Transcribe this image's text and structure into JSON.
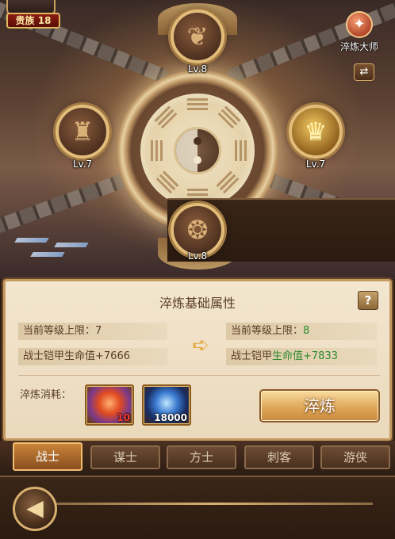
{
  "header": {
    "noble_badge": "贵族 18",
    "master_label": "淬炼大师",
    "master_icon": "refine-master-icon",
    "swap_icon": "swap-icon"
  },
  "slots": {
    "top": {
      "level": "Lv.8",
      "icon": "gauntlet-icon"
    },
    "left": {
      "level": "Lv.7",
      "icon": "armor-icon"
    },
    "right": {
      "level": "Lv.7",
      "icon": "helmet-icon"
    },
    "bottom": {
      "level": "Lv.8",
      "icon": "pendant-icon"
    }
  },
  "panel": {
    "title": "淬炼基础属性",
    "help_label": "?",
    "current": {
      "limit_label": "当前等级上限：",
      "limit_value": "7",
      "hp_label": "战士铠甲生命值+",
      "hp_value": "7666"
    },
    "next": {
      "limit_label": "当前等级上限：",
      "limit_value": "8",
      "hp_label": "战士铠甲",
      "hp_green": "生命值+7833"
    },
    "cost_label": "淬炼消耗：",
    "items": [
      {
        "count": "10",
        "icon": "fire-stone-icon"
      },
      {
        "count": "18000",
        "icon": "experience-orb-icon"
      }
    ],
    "refine_button": "淬炼"
  },
  "tabs": [
    "战士",
    "谋士",
    "方士",
    "刺客",
    "游侠"
  ],
  "active_tab": 0,
  "colors": {
    "accent": "#c9843a",
    "green": "#2e8a2e",
    "panel_bg": "#f3e6cf"
  }
}
